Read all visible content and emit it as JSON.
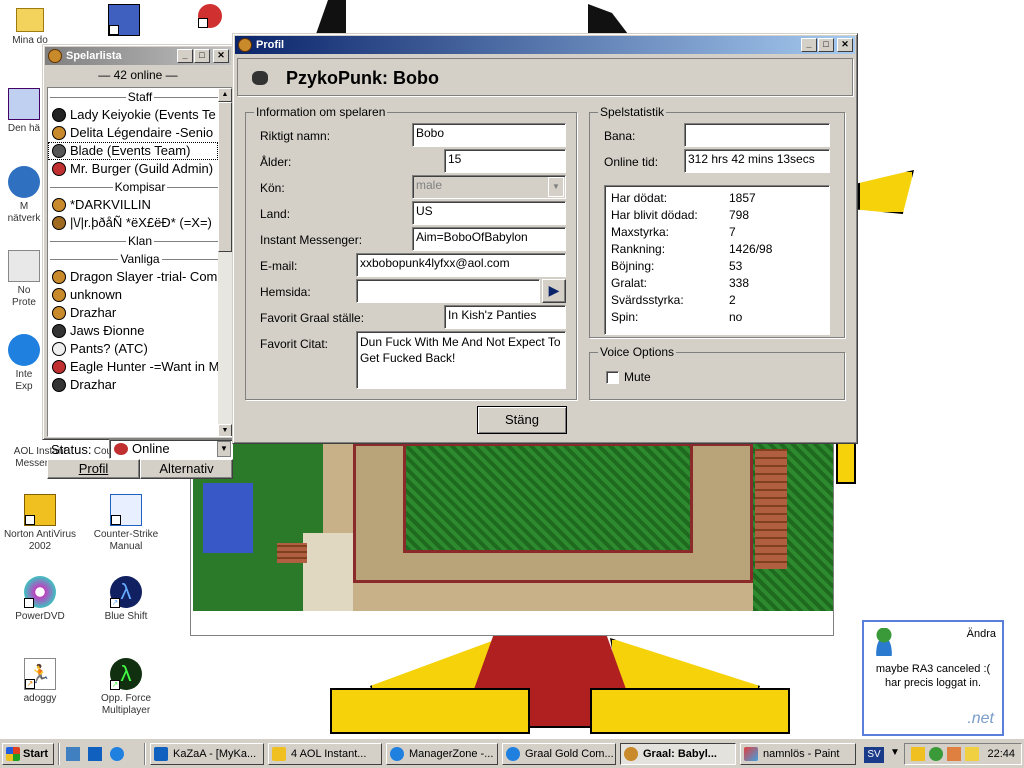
{
  "desktop": {
    "icons": [
      {
        "label": "Mina do",
        "icon": "folder-icon"
      },
      {
        "label": "",
        "icon": "zip-icon"
      },
      {
        "label": "",
        "icon": "shortcut-icon"
      },
      {
        "label": "Den hä",
        "icon": "computer-icon"
      },
      {
        "label": "M\nnätverk",
        "icon": "network-icon"
      },
      {
        "label": "No\nProte",
        "icon": "norton-icon"
      },
      {
        "label": "Inte\nExp",
        "icon": "ie-icon"
      },
      {
        "label": "AOL Instant\nMessenger",
        "icon": "aol-icon"
      },
      {
        "label": "Counter-Strike",
        "icon": "cs-icon"
      },
      {
        "label": "Norton AntiVirus\n2002",
        "icon": "norton-av-icon"
      },
      {
        "label": "Counter-Strike\nManual",
        "icon": "ie-doc-icon"
      },
      {
        "label": "PowerDVD",
        "icon": "dvd-icon"
      },
      {
        "label": "Blue Shift",
        "icon": "halflife-icon"
      },
      {
        "label": "adoggy",
        "icon": "runner-icon"
      },
      {
        "label": "Opp. Force\nMultiplayer",
        "icon": "halflife-green-icon"
      }
    ]
  },
  "playerlist": {
    "title": "Spelarlista",
    "online": "— 42 online —",
    "groups": [
      {
        "header": "Staff",
        "players": [
          "Lady Keiyokie (Events Te",
          "Delita Légendaire -Senio",
          "Blade (Events Team)",
          "Mr. Burger (Guild Admin)"
        ]
      },
      {
        "header": "Kompisar",
        "players": [
          "*DARKVILLIN",
          "|\\/|r.þðåÑ *ëX£ëÐ* (=X=)"
        ]
      },
      {
        "header": "Klan",
        "players": []
      },
      {
        "header": "Vanliga",
        "players": [
          "Dragon Slayer -trial- Com",
          "unknown",
          "Drazhar",
          "Jaws Ðionne",
          "Pants? (ATC)",
          "Eagle Hunter -=Want in M",
          "Drazhar"
        ]
      }
    ],
    "status_label": "Status:",
    "status_value": "Online",
    "btn_profil": "Profil",
    "btn_alternativ": "Alternativ"
  },
  "profile": {
    "title": "Profil",
    "heading": "PzykoPunk: Bobo",
    "info_legend": "Information om spelaren",
    "labels": {
      "name": "Riktigt namn:",
      "age": "Ålder:",
      "gender": "Kön:",
      "country": "Land:",
      "im": "Instant Messenger:",
      "email": "E-mail:",
      "homepage": "Hemsida:",
      "fav_place": "Favorit Graal ställe:",
      "fav_quote": "Favorit Citat:"
    },
    "values": {
      "name": "Bobo",
      "age": "15",
      "gender": "male",
      "country": "US",
      "im": "Aim=BoboOfBabylon",
      "email": "xxbobopunk4lyfxx@aol.com",
      "homepage": "",
      "fav_place": "In Kish'z Panties",
      "fav_quote": "Dun Fuck With Me And Not Expect To Get Fucked Back!"
    },
    "stats_legend": "Spelstatistik",
    "bana_label": "Bana:",
    "bana_value": "",
    "online_label": "Online tid:",
    "online_value": "312 hrs 42 mins 13secs",
    "stats": [
      {
        "k": "Har dödat:",
        "v": "1857"
      },
      {
        "k": "Har blivit dödad:",
        "v": "798"
      },
      {
        "k": "Maxstyrka:",
        "v": "7"
      },
      {
        "k": "Rankning:",
        "v": "1426/98"
      },
      {
        "k": "Böjning:",
        "v": "53"
      },
      {
        "k": "Gralat:",
        "v": "338"
      },
      {
        "k": "Svärdsstyrka:",
        "v": "2"
      },
      {
        "k": "Spin:",
        "v": "no"
      }
    ],
    "voice_legend": "Voice Options",
    "mute_label": "Mute",
    "mute_checked": false,
    "close_label": "Stäng"
  },
  "balloon": {
    "change_label": "Ändra",
    "message": "maybe RA3 canceled :(\nhar precis loggat in.",
    "brand": ".net"
  },
  "taskbar": {
    "start": "Start",
    "items": [
      {
        "label": "KaZaA - [MyKa...",
        "icon": "kazaa-icon",
        "pressed": false
      },
      {
        "label": "4 AOL Instant...",
        "icon": "aim-icon",
        "pressed": false
      },
      {
        "label": "ManagerZone -...",
        "icon": "ie-icon",
        "pressed": false
      },
      {
        "label": "Graal Gold Com...",
        "icon": "ie-icon",
        "pressed": false
      },
      {
        "label": "Graal: Babyl...",
        "icon": "graal-icon",
        "pressed": true
      },
      {
        "label": "namnlös - Paint",
        "icon": "paint-icon",
        "pressed": false
      }
    ],
    "lang": "SV",
    "clock": "22:44"
  }
}
